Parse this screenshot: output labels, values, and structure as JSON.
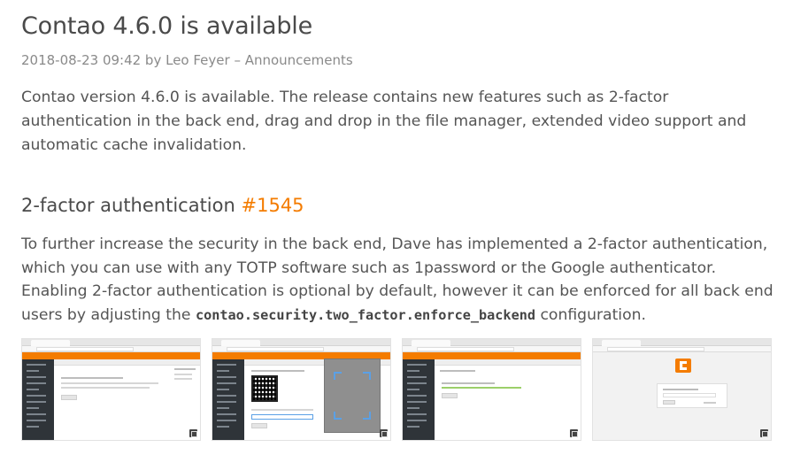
{
  "article": {
    "title": "Contao 4.6.0 is available",
    "meta": "2018-08-23 09:42 by Leo Feyer – Announcements",
    "intro": "Contao version 4.6.0 is available. The release contains new features such as 2-factor authentication in the back end, drag and drop in the file manager, extended video support and automatic cache invalidation."
  },
  "section": {
    "heading": "2-factor authentication",
    "issue_link": "#1545",
    "text_before_code": "To further increase the security in the back end, Dave has implemented a 2-factor authentication, which you can use with any TOTP software such as 1password or the Google authenticator. Enabling 2-factor authentication is optional by default, however it can be enforced for all back end users by adjusting the ",
    "code": "contao.security.two_factor.enforce_backend",
    "text_after_code": " configuration."
  },
  "gallery": {
    "thumbnails": [
      {
        "name": "screenshot-2fa-settings"
      },
      {
        "name": "screenshot-2fa-qr-code"
      },
      {
        "name": "screenshot-2fa-enabled"
      },
      {
        "name": "screenshot-2fa-login"
      }
    ],
    "expand_icon": "expand-icon"
  },
  "colors": {
    "accent": "#f47c00",
    "text": "#555555",
    "heading": "#4a4a4a",
    "meta": "#8a8a8a"
  }
}
